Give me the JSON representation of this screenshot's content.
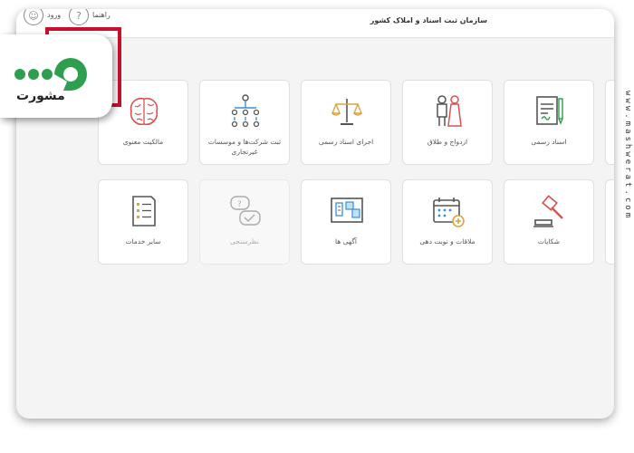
{
  "header": {
    "site_title": "سازمان ثبت اسناد و املاک کشور",
    "help_label": "راهنما",
    "login_label": "ورود"
  },
  "cards_row1": [
    {
      "label": "اسناد رسمی",
      "icon": "document-pen-icon"
    },
    {
      "label": "ازدواج و طلاق",
      "icon": "bride-groom-icon"
    },
    {
      "label": "اجرای اسناد رسمی",
      "icon": "scales-icon"
    },
    {
      "label": "ثبت شرکت‌ها و موسسات غیرتجاری",
      "icon": "org-chart-icon"
    },
    {
      "label": "مالکیت معنوی",
      "icon": "brain-icon"
    }
  ],
  "cards_row2": [
    {
      "label": "شکایات",
      "icon": "gavel-icon"
    },
    {
      "label": "ملاقات و نوبت دهی",
      "icon": "calendar-add-icon"
    },
    {
      "label": "آگهی ها",
      "icon": "notice-board-icon"
    },
    {
      "label": "نظرسنجی",
      "icon": "survey-bubbles-icon",
      "disabled": true
    },
    {
      "label": "سایر خدمات",
      "icon": "checklist-icon"
    }
  ],
  "logo": {
    "text": "مشورت"
  },
  "watermark": "www.mashwerat.com",
  "colors": {
    "accent_green": "#2e9e4f",
    "accent_red": "#d9534f",
    "highlight": "#c8102e",
    "gold": "#d9a441"
  }
}
